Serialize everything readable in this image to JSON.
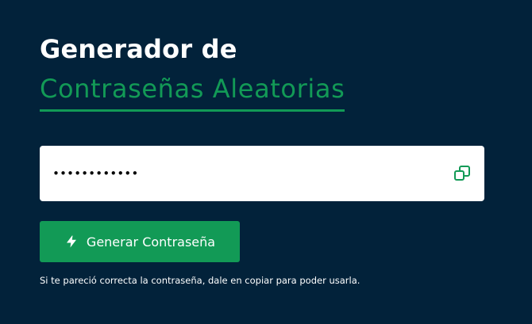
{
  "header": {
    "title_line1": "Generador de",
    "title_line2": "Contraseñas Aleatorias"
  },
  "password": {
    "value": "************",
    "masked": true
  },
  "actions": {
    "copy_icon": "copy-icon",
    "generate_label": "Generar Contraseña",
    "generate_icon": "bolt-icon"
  },
  "hint": "Si te pareció correcta la contraseña, dale en copiar para poder usarla.",
  "colors": {
    "background": "#02223a",
    "accent": "#129a56",
    "white": "#ffffff"
  }
}
